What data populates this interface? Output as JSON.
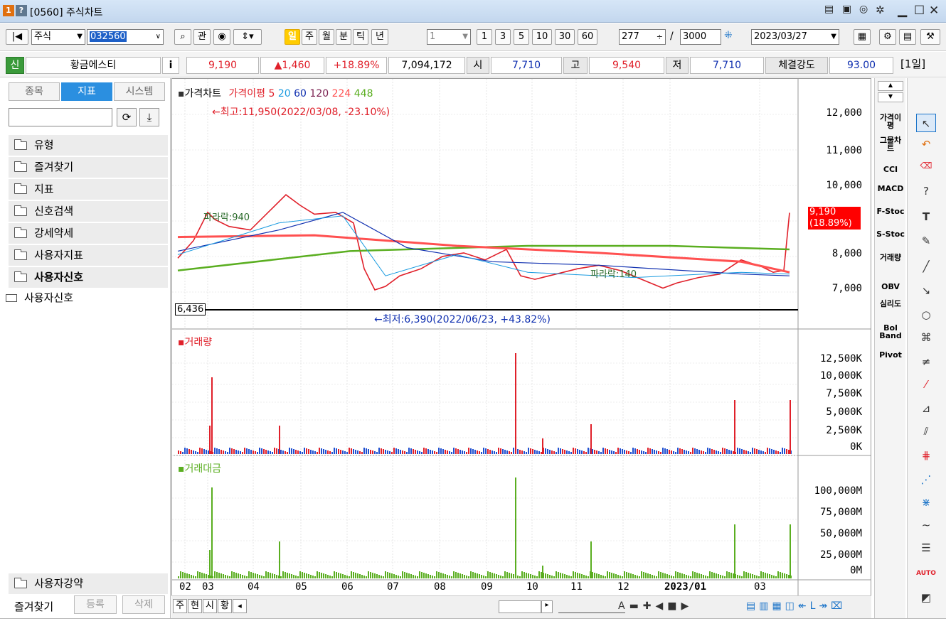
{
  "window": {
    "title": "[0560] 주식차트",
    "badge1": "1",
    "badge2": "?"
  },
  "toolbar": {
    "market": "주식",
    "code": "032560",
    "search_btn": "⌕",
    "gwan": "관",
    "periods": [
      "일",
      "주",
      "월",
      "분",
      "틱",
      "년"
    ],
    "interval_value": "1",
    "intervals": [
      "1",
      "3",
      "5",
      "10",
      "30",
      "60"
    ],
    "count": "277",
    "slash": "/",
    "total": "3000",
    "date": "2023/03/27"
  },
  "info": {
    "sin": "신",
    "name": "황금에스티",
    "i_btn": "i",
    "price": "9,190",
    "change": "▲1,460",
    "change_pct": "+18.89%",
    "volume": "7,094,172",
    "open_label": "시",
    "open": "7,710",
    "high_label": "고",
    "high": "9,540",
    "low_label": "저",
    "low": "7,710",
    "strength_label": "체결강도",
    "strength": "93.00",
    "period_btn": "[1일]"
  },
  "left": {
    "tabs": [
      "종목",
      "지표",
      "시스템"
    ],
    "folders": [
      "유형",
      "즐겨찾기",
      "지표",
      "신호검색",
      "강세약세",
      "사용자지표",
      "사용자신호"
    ],
    "open_item": "사용자신호",
    "bottom_folder": "사용자강약",
    "bottom_label": "즐겨찾기",
    "bottom_btns": [
      "등록",
      "삭제"
    ]
  },
  "chart": {
    "legend_price": "가격차트",
    "legend_ma": "가격이평",
    "ma_periods": [
      "5",
      "20",
      "60",
      "120",
      "224",
      "448"
    ],
    "max_note": "←최고:11,950(2022/03/08, -23.10%)",
    "min_note": "←최저:6,390(2022/06/23, +43.82%)",
    "ref_line_label": "6,436",
    "annot1": "파라락:940",
    "annot2": "파라락:140",
    "price_tag_1": "9,190",
    "price_tag_2": "(18.89%)",
    "price_ticks": [
      "12,000",
      "11,000",
      "10,000",
      "8,000",
      "7,000"
    ],
    "vol_title": "거래량",
    "vol_ticks": [
      "12,500K",
      "10,000K",
      "7,500K",
      "5,000K",
      "2,500K",
      "0K"
    ],
    "amt_title": "거래대금",
    "amt_ticks": [
      "100,000M",
      "75,000M",
      "50,000M",
      "25,000M",
      "0M"
    ],
    "x_ticks": [
      "02",
      "03",
      "04",
      "05",
      "06",
      "07",
      "08",
      "09",
      "10",
      "11",
      "12",
      "2023/01",
      "03"
    ],
    "colors": {
      "ma5": "#e0202a",
      "ma20": "#1a9be0",
      "ma60": "#1030b0",
      "ma120": "#7a1f4f",
      "ma224": "#ff5050",
      "ma448": "#5aae20",
      "up": "#e0202a",
      "down": "#2050d0",
      "amount": "#5aae20"
    }
  },
  "indicators": [
    "가격이평",
    "그물차트",
    "CCI",
    "MACD",
    "F-Stoc",
    "S-Stoc",
    "거래량",
    "OBV",
    "심리도",
    "Bol Band",
    "Pivot"
  ],
  "bottom": {
    "btns": [
      "주",
      "현",
      "시",
      "황"
    ]
  }
}
